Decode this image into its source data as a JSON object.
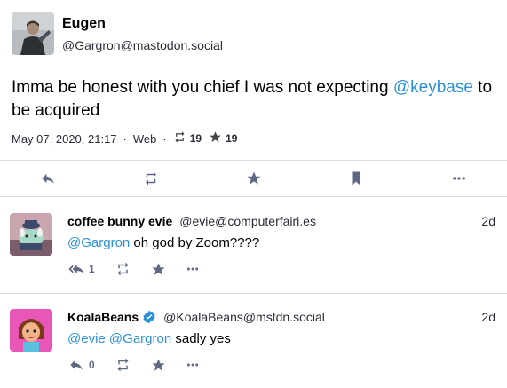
{
  "status": {
    "author_name": "Eugen",
    "author_handle": "@Gargron@mastodon.social",
    "content_before": "Imma be honest with you chief I was not expecting ",
    "content_mention": "@keybase",
    "content_after": " to be acquired",
    "date": "May 07, 2020, 21:17",
    "separator": "·",
    "app": "Web",
    "reblogs": "19",
    "favourites": "19"
  },
  "actions": {
    "reply": "reply-icon",
    "boost": "retweet-icon",
    "favourite": "star-icon",
    "bookmark": "bookmark-icon",
    "more": "ellipsis-icon"
  },
  "replies": [
    {
      "author_name": "coffee bunny evie",
      "author_handle": "@evie@computerfairi.es",
      "time": "2d",
      "mention1": "@Gargron",
      "text": " oh god by Zoom????",
      "reply_count": "1"
    },
    {
      "author_name": "KoalaBeans",
      "author_handle": "@KoalaBeans@mstdn.social",
      "time": "2d",
      "mention1": "@evie",
      "mention2": "@Gargron",
      "text": " sadly yes",
      "reply_count": "0"
    }
  ],
  "colors": {
    "link": "#2b90d9",
    "icon": "#606984",
    "verified": "#2b90d9"
  }
}
